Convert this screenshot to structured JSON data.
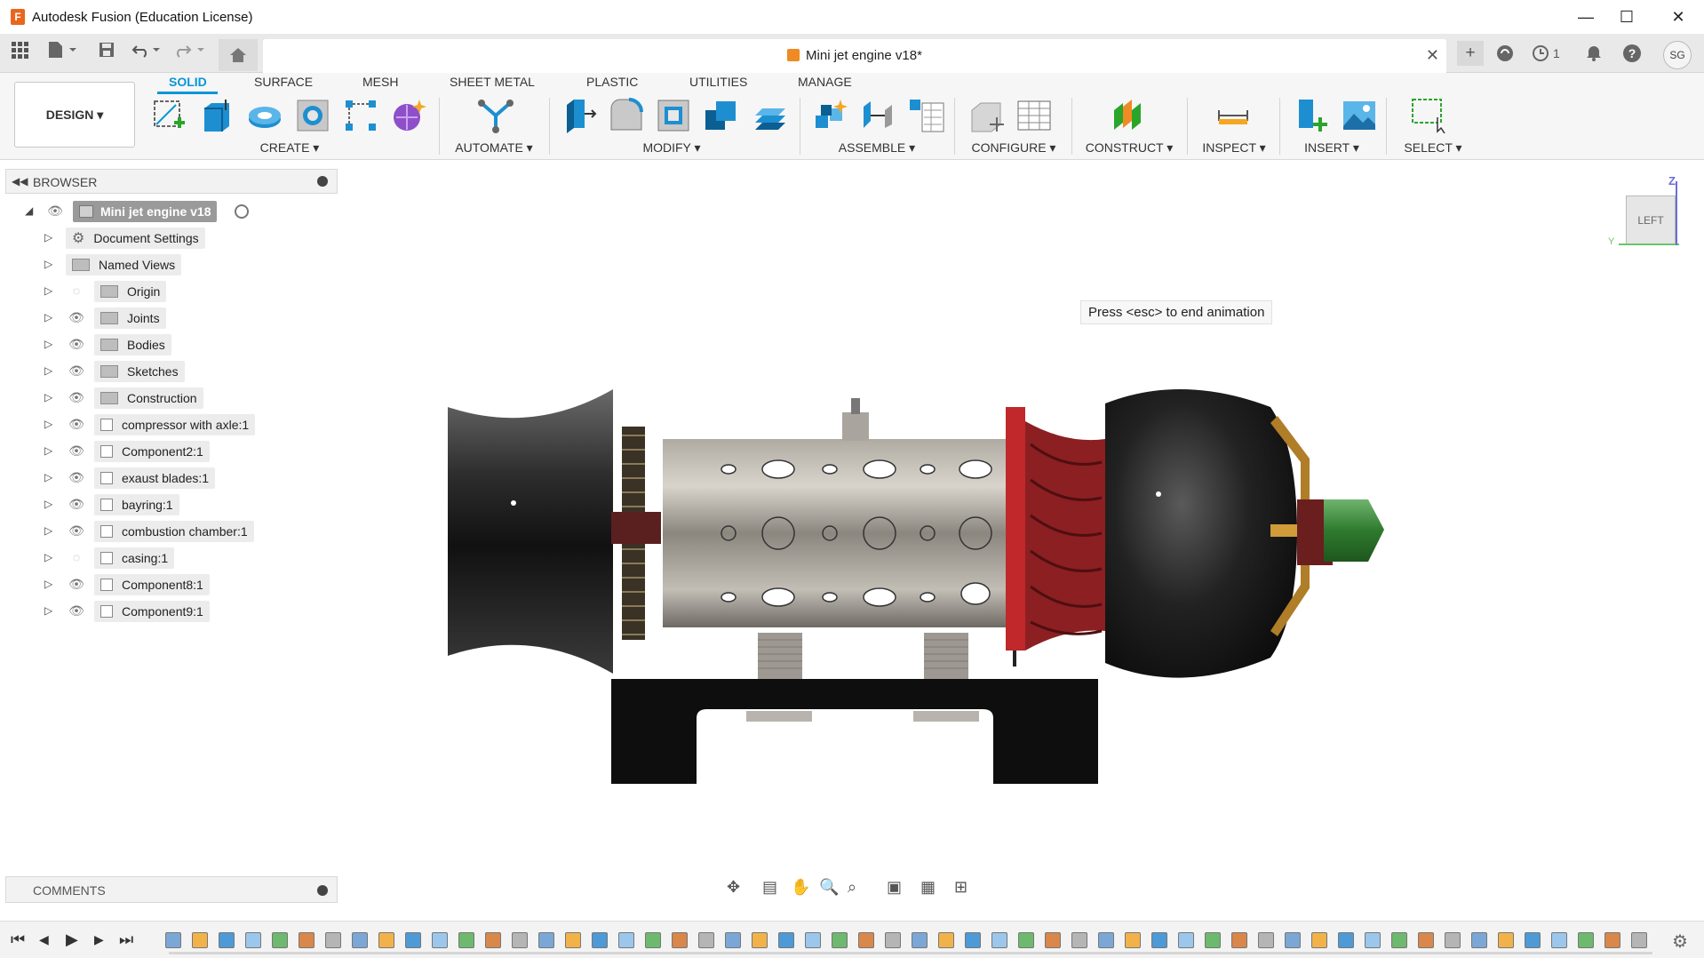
{
  "app": {
    "title": "Autodesk Fusion (Education License)",
    "logo_letter": "F",
    "window_controls": [
      "—",
      "☐",
      "✕"
    ]
  },
  "document": {
    "tab_title": "Mini jet engine v18*",
    "close_glyph": "✕"
  },
  "quick_access": {
    "notifications_count": "1",
    "user_initials": "SG"
  },
  "ribbon": {
    "workspace": "DESIGN ▾",
    "tabs": [
      "SOLID",
      "SURFACE",
      "MESH",
      "SHEET METAL",
      "PLASTIC",
      "UTILITIES",
      "MANAGE"
    ],
    "active_tab": "SOLID",
    "groups": [
      "CREATE ▾",
      "AUTOMATE ▾",
      "MODIFY ▾",
      "ASSEMBLE ▾",
      "CONFIGURE ▾",
      "CONSTRUCT ▾",
      "INSPECT ▾",
      "INSERT ▾",
      "SELECT ▾"
    ]
  },
  "browser": {
    "title": "BROWSER",
    "root": "Mini jet engine v18",
    "items": [
      {
        "label": "Document Settings",
        "icon": "gear-icon",
        "visible": "none"
      },
      {
        "label": "Named Views",
        "icon": "folder-icon",
        "visible": "none"
      },
      {
        "label": "Origin",
        "icon": "folder-icon",
        "visible": "hidden"
      },
      {
        "label": "Joints",
        "icon": "folder-icon",
        "visible": "shown"
      },
      {
        "label": "Bodies",
        "icon": "folder-icon",
        "visible": "shown"
      },
      {
        "label": "Sketches",
        "icon": "folder-icon",
        "visible": "shown"
      },
      {
        "label": "Construction",
        "icon": "folder-icon",
        "visible": "shown"
      },
      {
        "label": "compressor with axle:1",
        "icon": "component-icon",
        "visible": "shown"
      },
      {
        "label": "Component2:1",
        "icon": "component-icon",
        "visible": "shown"
      },
      {
        "label": "exaust blades:1",
        "icon": "component-icon",
        "visible": "shown"
      },
      {
        "label": "bayring:1",
        "icon": "component-icon",
        "visible": "shown"
      },
      {
        "label": "combustion chamber:1",
        "icon": "component-icon",
        "visible": "shown"
      },
      {
        "label": "casing:1",
        "icon": "component-icon",
        "visible": "hidden"
      },
      {
        "label": "Component8:1",
        "icon": "component-icon",
        "visible": "shown"
      },
      {
        "label": "Component9:1",
        "icon": "component-icon",
        "visible": "shown"
      }
    ]
  },
  "viewport": {
    "tooltip": "Press <esc> to end animation",
    "viewcube_face": "LEFT",
    "axis_z": "Z",
    "axis_y": "Y"
  },
  "comments": {
    "title": "COMMENTS"
  },
  "timeline": {
    "controls": [
      "skip-to-start",
      "step-back",
      "play",
      "step-forward",
      "skip-to-end"
    ],
    "control_glyphs": [
      "⏮",
      "◀",
      "▶",
      "▶",
      "⏭"
    ]
  }
}
